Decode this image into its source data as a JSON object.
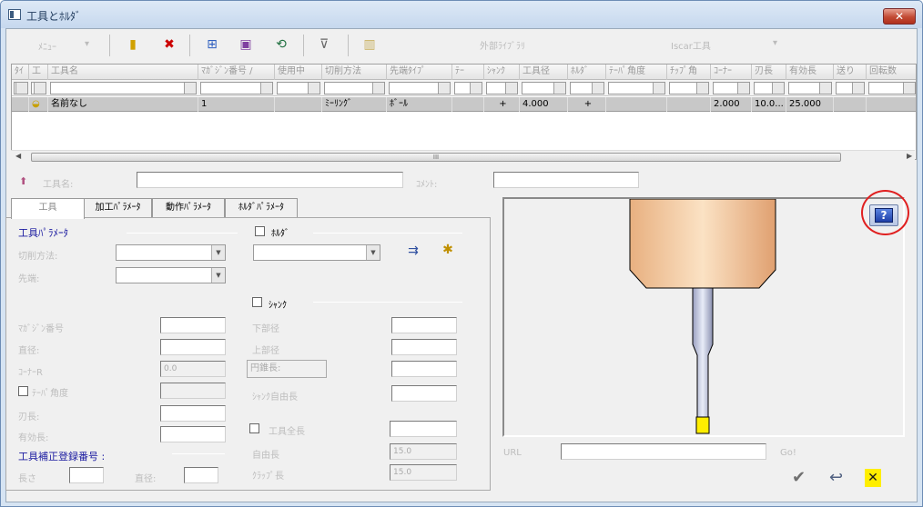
{
  "window": {
    "title": "工具とﾎﾙﾀﾞ",
    "close": "✕"
  },
  "toolbar": {
    "menu": "ﾒﾆｭｰ",
    "menu_arrow": "▾",
    "external_library": "外部ﾗｲﾌﾞﾗﾘ",
    "iscar": "Iscar工具",
    "iscar_arrow": "▾"
  },
  "grid": {
    "headers": [
      "ﾀｲ",
      "工",
      "工具名",
      "ﾏｶﾞｼﾞﾝ番号 /",
      "使用中",
      "切削方法",
      "先端ﾀｲﾌﾟ",
      "ﾃｰ",
      "ｼｬﾝｸ",
      "工具径",
      "ﾎﾙﾀﾞ",
      "ﾃｰﾊﾟ角度",
      "ﾁｯﾌﾟ角",
      "ｺｰﾅｰ",
      "刃長",
      "有効長",
      "送り",
      "回転数"
    ],
    "row": {
      "icon": "",
      "name": "名前なし",
      "magazine": "1",
      "method": "ﾐｰﾘﾝｸﾞ",
      "tip": "ﾎﾞｰﾙ",
      "shank": "+",
      "diameter": "4.000",
      "holder": "+",
      "corner": "2.000",
      "blade": "10.0...",
      "effective": "25.000"
    },
    "scroll_grip": "III"
  },
  "toolname": {
    "label": "工具名:",
    "comment_label": "ｺﾒﾝﾄ:"
  },
  "tabs": [
    "工具",
    "加工ﾊﾟﾗﾒｰﾀ",
    "動作ﾊﾟﾗﾒｰﾀ",
    "ﾎﾙﾀﾞﾊﾟﾗﾒｰﾀ"
  ],
  "toolparams": {
    "title": "工具ﾊﾟﾗﾒｰﾀ",
    "cut_method": "切削方法:",
    "tip": "先端:",
    "magazine": "ﾏｶﾞｼﾞﾝ番号",
    "diameter": "直径:",
    "corner": "ｺｰﾅｰR",
    "corner_val": "0.0",
    "taper": "ﾃｰﾊﾟ角度",
    "blade": "刃長:",
    "effective": "有効長:",
    "offset_title": "工具補正登録番号 :",
    "length": "長さ",
    "diam2": "直径:"
  },
  "holder": {
    "label": "ﾎﾙﾀﾞ"
  },
  "shank": {
    "label": "ｼｬﾝｸ",
    "lower_diam": "下部径",
    "upper_diam": "上部径",
    "cone_length": "円錐長:",
    "free_length": "ｼｬﾝｸ自由長"
  },
  "total": {
    "label": "工具全長",
    "free": "自由長",
    "clamp": "ｸﾗｯﾌﾟ長",
    "free_val": "15.0",
    "clamp_val": "15.0"
  },
  "url": {
    "label": "URL",
    "go": "Go!"
  },
  "help": "?",
  "bottom": {
    "ok": "✔",
    "back": "↩",
    "cancel": "✕"
  }
}
